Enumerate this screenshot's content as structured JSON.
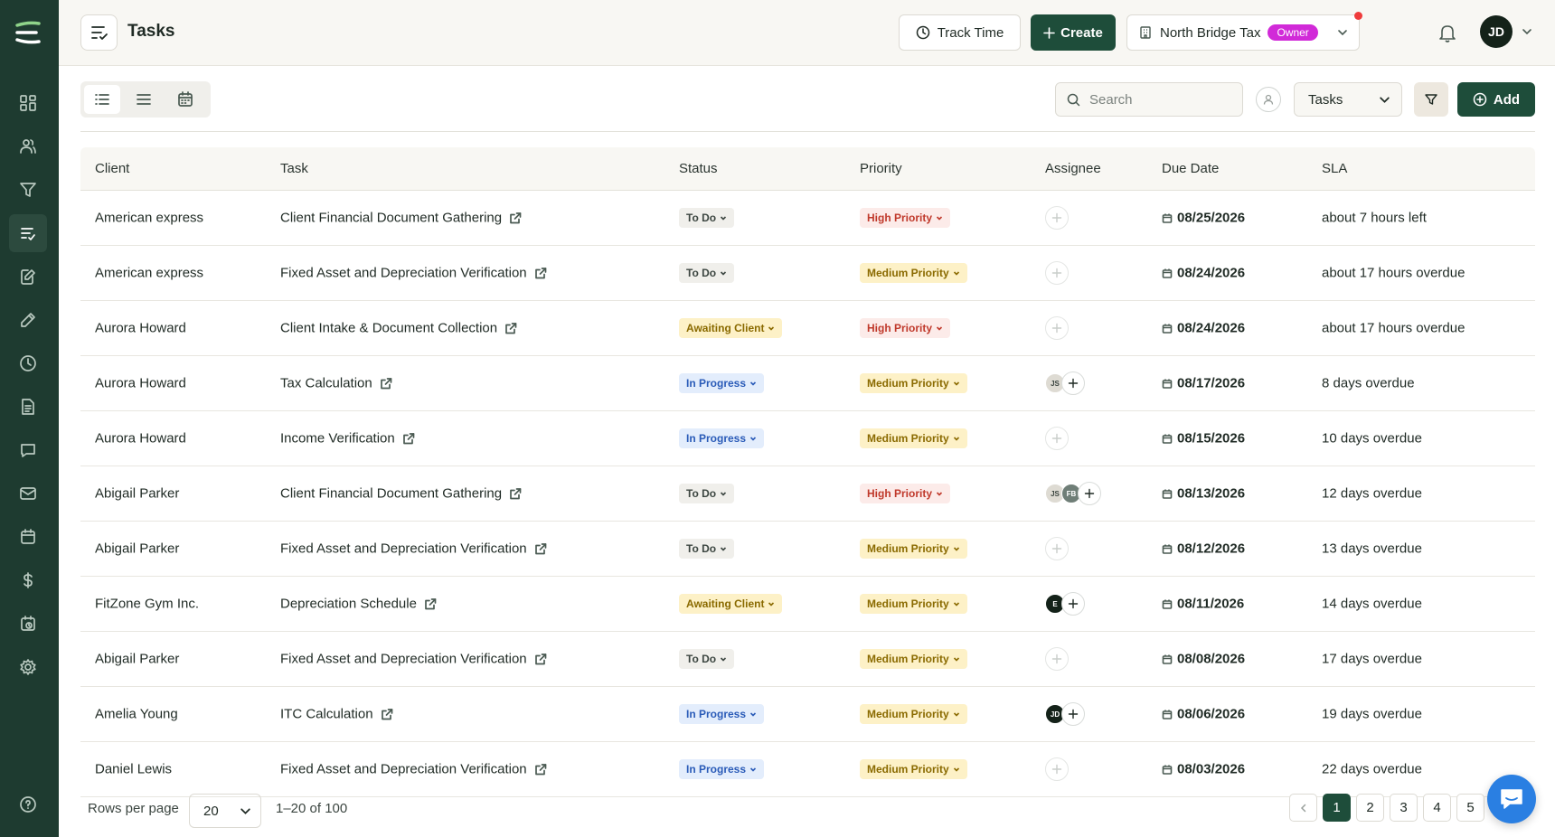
{
  "header": {
    "title": "Tasks",
    "track_time": "Track Time",
    "create": "Create",
    "organization": "North Bridge Tax",
    "role_badge": "Owner",
    "user_initials": "JD"
  },
  "toolbar": {
    "search_placeholder": "Search",
    "view_select": "Tasks",
    "add": "Add"
  },
  "colors": {
    "brand": "#1e4d3a",
    "sidebar": "#1e3b30",
    "owner_badge": "#d12ad8",
    "notification": "#ef3b3b",
    "chat": "#2a7fe2"
  },
  "sidebar": {
    "icons": [
      "logo-icon",
      "dashboard-icon",
      "clients-icon",
      "funnel-icon",
      "tasks-icon",
      "edit-document-icon",
      "pen-icon",
      "clock-icon",
      "invoice-icon",
      "chat-icon",
      "mail-icon",
      "calendar-icon",
      "dollar-icon",
      "schedule-icon",
      "settings-icon",
      "help-icon"
    ],
    "active": "tasks-icon"
  },
  "table": {
    "columns": [
      "Client",
      "Task",
      "Status",
      "Priority",
      "Assignee",
      "Due Date",
      "SLA"
    ],
    "rows": [
      {
        "client": "American express",
        "task": "Client Financial Document Gathering",
        "status": "To Do",
        "priority": "High Priority",
        "assignees": [],
        "due": "08/25/2026",
        "sla": "about 7 hours left"
      },
      {
        "client": "American express",
        "task": "Fixed Asset and Depreciation Verification",
        "status": "To Do",
        "priority": "Medium Priority",
        "assignees": [],
        "due": "08/24/2026",
        "sla": "about 17 hours overdue"
      },
      {
        "client": "Aurora Howard",
        "task": "Client Intake & Document Collection",
        "status": "Awaiting Client",
        "priority": "High Priority",
        "assignees": [],
        "due": "08/24/2026",
        "sla": "about 17 hours overdue"
      },
      {
        "client": "Aurora Howard",
        "task": "Tax Calculation",
        "status": "In Progress",
        "priority": "Medium Priority",
        "assignees": [
          "JS"
        ],
        "due": "08/17/2026",
        "sla": "8 days overdue"
      },
      {
        "client": "Aurora Howard",
        "task": "Income Verification",
        "status": "In Progress",
        "priority": "Medium Priority",
        "assignees": [],
        "due": "08/15/2026",
        "sla": "10 days overdue"
      },
      {
        "client": "Abigail Parker",
        "task": "Client Financial Document Gathering",
        "status": "To Do",
        "priority": "High Priority",
        "assignees": [
          "JS",
          "FB"
        ],
        "due": "08/13/2026",
        "sla": "12 days overdue"
      },
      {
        "client": "Abigail Parker",
        "task": "Fixed Asset and Depreciation Verification",
        "status": "To Do",
        "priority": "Medium Priority",
        "assignees": [],
        "due": "08/12/2026",
        "sla": "13 days overdue"
      },
      {
        "client": "FitZone Gym Inc.",
        "task": "Depreciation Schedule",
        "status": "Awaiting Client",
        "priority": "Medium Priority",
        "assignees": [
          "E"
        ],
        "due": "08/11/2026",
        "sla": "14 days overdue"
      },
      {
        "client": "Abigail Parker",
        "task": "Fixed Asset and Depreciation Verification",
        "status": "To Do",
        "priority": "Medium Priority",
        "assignees": [],
        "due": "08/08/2026",
        "sla": "17 days overdue"
      },
      {
        "client": "Amelia Young",
        "task": "ITC Calculation",
        "status": "In Progress",
        "priority": "Medium Priority",
        "assignees": [
          "JD"
        ],
        "due": "08/06/2026",
        "sla": "19 days overdue"
      },
      {
        "client": "Daniel Lewis",
        "task": "Fixed Asset and Depreciation Verification",
        "status": "In Progress",
        "priority": "Medium Priority",
        "assignees": [],
        "due": "08/03/2026",
        "sla": "22 days overdue"
      }
    ]
  },
  "pagination": {
    "rows_per_page_label": "Rows per page",
    "rows_per_page": "20",
    "range": "1–20 of 100",
    "pages": [
      "1",
      "2",
      "3",
      "4",
      "5"
    ],
    "current": "1"
  }
}
